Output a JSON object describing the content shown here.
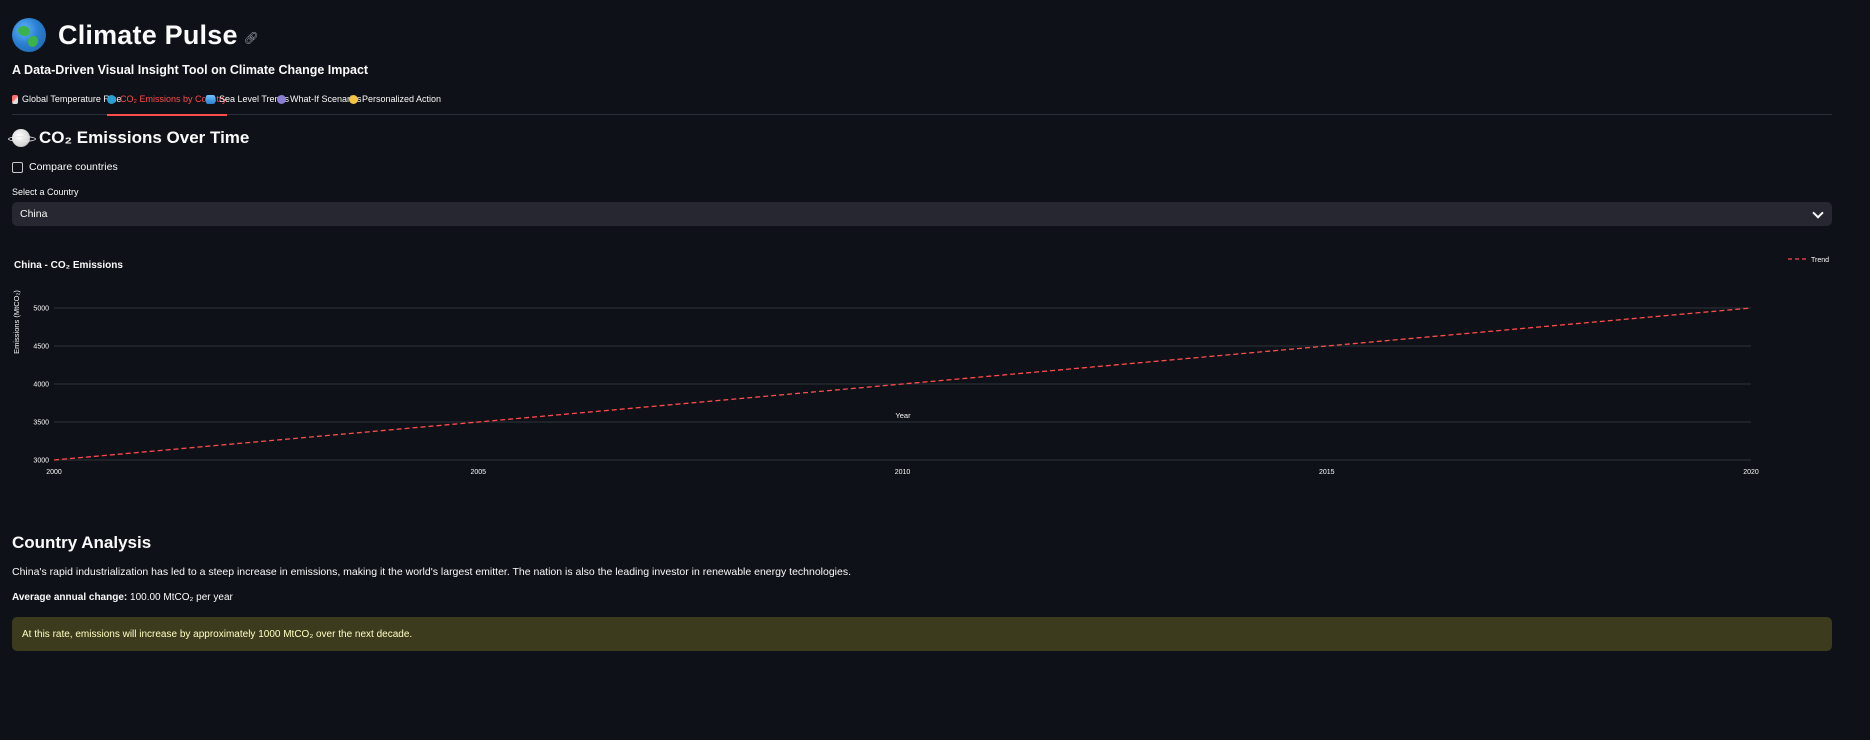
{
  "app": {
    "title": "Climate Pulse",
    "link_icon": "link-icon",
    "subtitle": "A Data-Driven Visual Insight Tool on Climate Change Impact"
  },
  "tabs": [
    {
      "label": "Global Temperature Rise",
      "icon": "thermometer-icon",
      "active": false
    },
    {
      "label": "CO₂ Emissions by Country",
      "icon": "globe-icon",
      "active": true
    },
    {
      "label": "Sea Level Trends",
      "icon": "wave-icon",
      "active": false
    },
    {
      "label": "What-If Scenarios",
      "icon": "crystal-ball-icon",
      "active": false
    },
    {
      "label": "Personalized Action",
      "icon": "smiley-icon",
      "active": false
    }
  ],
  "section": {
    "title": "CO₂ Emissions Over Time",
    "icon": "planet-icon"
  },
  "compare": {
    "label": "Compare countries",
    "checked": false
  },
  "country_select": {
    "label": "Select a Country",
    "value": "China"
  },
  "chart_data": {
    "type": "line",
    "title": "China - CO₂ Emissions",
    "xlabel": "Year",
    "ylabel": "Emissions (MtCO₂)",
    "x": [
      2000,
      2020
    ],
    "series": [
      {
        "name": "Trend",
        "values": [
          3000,
          5000
        ],
        "color": "#ff4b4b",
        "dash": true
      }
    ],
    "x_ticks": [
      "2000",
      "2005",
      "2010",
      "2015",
      "2020"
    ],
    "y_ticks": [
      "3000",
      "3500",
      "4000",
      "4500",
      "5000"
    ],
    "xlim": [
      2000,
      2020
    ],
    "ylim": [
      3000,
      5000
    ],
    "grid": true,
    "legend": "top-right"
  },
  "analysis": {
    "title": "Country Analysis",
    "text": "China's rapid industrialization has led to a steep increase in emissions, making it the world's largest emitter. The nation is also the leading investor in renewable energy technologies.",
    "avg_label": "Average annual change:",
    "avg_value": "100.00 MtCO₂ per year",
    "alert": "At this rate, emissions will increase by approximately 1000 MtCO₂ over the next decade."
  },
  "colors": {
    "background": "#0e1117",
    "accent": "#ff4b4b",
    "alert_bg": "#3d3b1e",
    "alert_text": "#ffffc2"
  }
}
